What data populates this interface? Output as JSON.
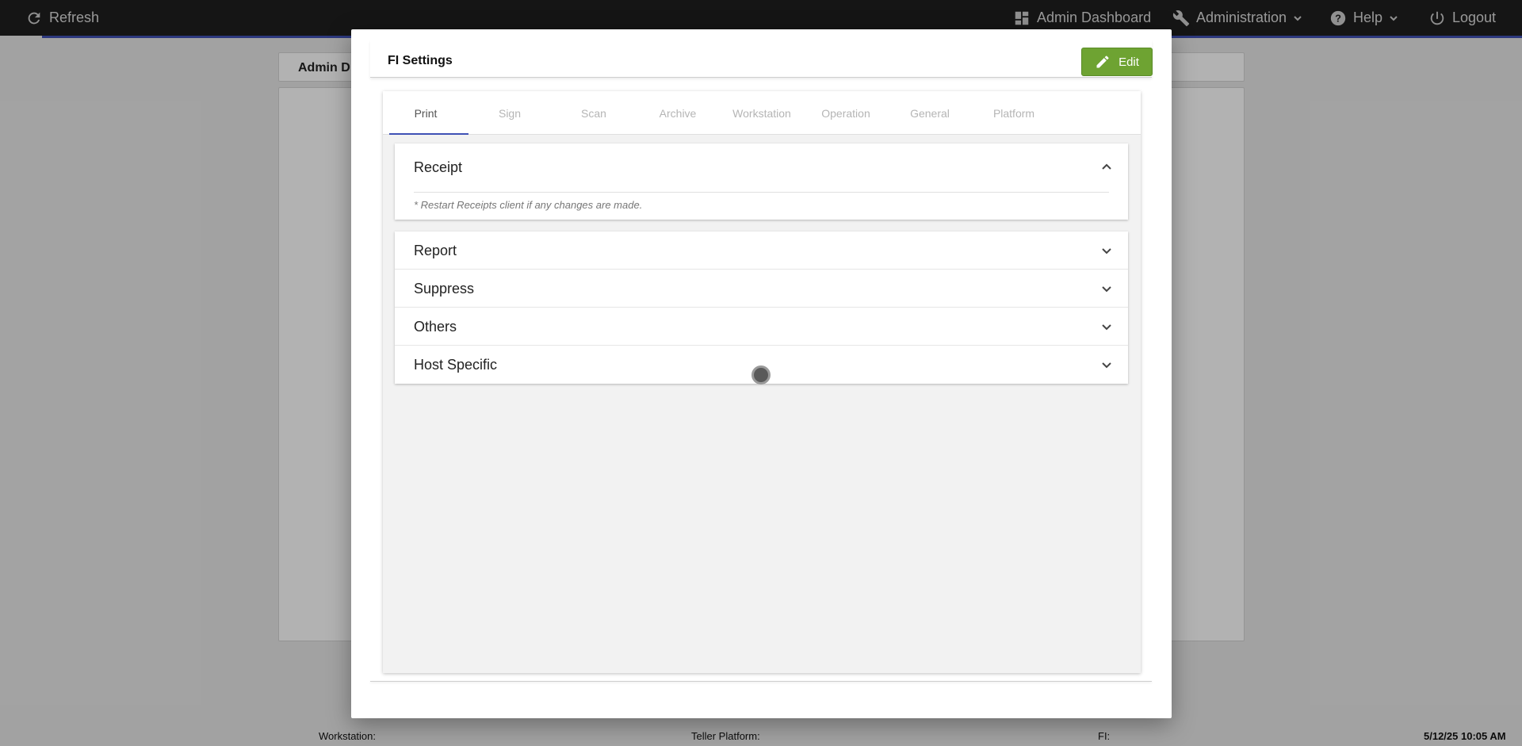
{
  "topbar": {
    "refresh_label": "Refresh",
    "admin_dashboard_label": "Admin Dashboard",
    "administration_label": "Administration",
    "help_label": "Help",
    "logout_label": "Logout",
    "accent_color": "#3f51b5"
  },
  "background": {
    "header_title": "Admin D"
  },
  "statusbar": {
    "workstation_label": "Workstation:",
    "teller_platform_label": "Teller Platform:",
    "fi_label": "FI:",
    "datetime": "5/12/25 10:05 AM"
  },
  "modal": {
    "title": "FI Settings",
    "edit_label": "Edit",
    "edit_color": "#6ea332",
    "tabs": [
      {
        "label": "Print",
        "active": true
      },
      {
        "label": "Sign",
        "active": false
      },
      {
        "label": "Scan",
        "active": false
      },
      {
        "label": "Archive",
        "active": false
      },
      {
        "label": "Workstation",
        "active": false
      },
      {
        "label": "Operation",
        "active": false
      },
      {
        "label": "General",
        "active": false
      },
      {
        "label": "Platform",
        "active": false
      }
    ],
    "receipt": {
      "title": "Receipt",
      "note": "* Restart Receipts client if any changes are made.",
      "expanded": true
    },
    "sections": [
      {
        "title": "Report"
      },
      {
        "title": "Suppress"
      },
      {
        "title": "Others"
      },
      {
        "title": "Host Specific"
      }
    ]
  }
}
